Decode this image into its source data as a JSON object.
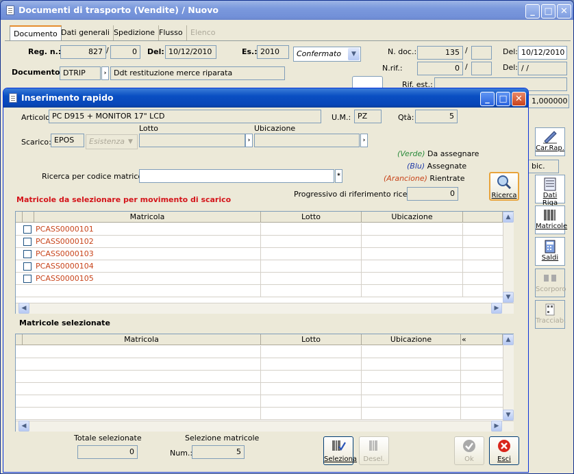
{
  "main_window": {
    "title": "Documenti di trasporto  (Vendite) / Nuovo",
    "tabs": [
      "Documento",
      "Dati generali",
      "Spedizione",
      "Flusso",
      "Elenco"
    ],
    "reg_label": "Reg. n.:",
    "reg_num": "827",
    "reg_sep": "/",
    "reg_suffix": "0",
    "del_label": "Del:",
    "del_value": "10/12/2010",
    "es_label": "Es.:",
    "es_value": "2010",
    "status_value": "Confermato",
    "ndoc_label": "N. doc.:",
    "ndoc_value": "135",
    "ndoc_sep": "/",
    "ndoc_del_label": "Del:",
    "ndoc_del_value": "10/12/2010",
    "nrif_label": "N.rif.:",
    "nrif_value": "0",
    "nrif_sep": "/",
    "nrif_del_label": "Del:",
    "nrif_del_value": " /  /",
    "documento_label": "Documento:",
    "documento_code": "DTRIP",
    "documento_desc": "Ddt restituzione merce riparata",
    "rif_est_label": "Rif. est.:",
    "partial_value": "1,000000",
    "partial_text": "bic.",
    "side_buttons": {
      "car_rap": "Car.Rap.",
      "dati_riga": "Dati Riga",
      "matricole": "Matricole",
      "saldi": "Saldi",
      "scorporo": "Scorporo",
      "tracciab": "Tracciab."
    }
  },
  "dialog": {
    "title": "Inserimento rapido",
    "articolo_label": "Articolo:",
    "articolo_value": "PC D915 + MONITOR 17\" LCD",
    "um_label": "U.M.:",
    "um_value": "PZ",
    "qta_label": "Qtà:",
    "qta_value": "5",
    "scarico_label": "Scarico:",
    "scarico_value": "EPOS",
    "esistenza_value": "Esistenza",
    "lotto_label": "Lotto",
    "ubicazione_label": "Ubicazione",
    "legend": {
      "verde_tag": "(Verde)",
      "verde_text": "Da assegnare",
      "blu_tag": "(Blu)",
      "blu_text": "Assegnate",
      "arancione_tag": "(Arancione)",
      "arancione_text": "Rientrate",
      "verde_color": "#2a8a3a",
      "blu_color": "#1f3aa8",
      "arancione_color": "#c8441a"
    },
    "ricerca_codice_label": "Ricerca per codice matricola:",
    "progressivo_label": "Progressivo di riferimento ricerca:",
    "progressivo_value": "0",
    "ricerca_button": "Ricerca",
    "section1_title": "Matricole da selezionare per movimento di scarico",
    "section1_color": "#d4141a",
    "grid1": {
      "headers": [
        "Matricola",
        "Lotto",
        "Ubicazione"
      ],
      "rows": [
        {
          "matricola": "PCASS0000101",
          "lotto": "",
          "ubicazione": ""
        },
        {
          "matricola": "PCASS0000102",
          "lotto": "",
          "ubicazione": ""
        },
        {
          "matricola": "PCASS0000103",
          "lotto": "",
          "ubicazione": ""
        },
        {
          "matricola": "PCASS0000104",
          "lotto": "",
          "ubicazione": ""
        },
        {
          "matricola": "PCASS0000105",
          "lotto": "",
          "ubicazione": ""
        }
      ],
      "row_color": "#c8441a"
    },
    "section2_title": "Matricole selezionate",
    "grid2": {
      "headers": [
        "Matricola",
        "Lotto",
        "Ubicazione"
      ],
      "extra_header": "«"
    },
    "totale_label": "Totale selezionate",
    "totale_value": "0",
    "selezione_label": "Selezione matricole",
    "num_label": "Num.:",
    "num_value": "5",
    "seleziona_button": "Seleziona",
    "desel_button": "Desel.",
    "ok_button": "Ok",
    "esci_button": "Esci"
  }
}
